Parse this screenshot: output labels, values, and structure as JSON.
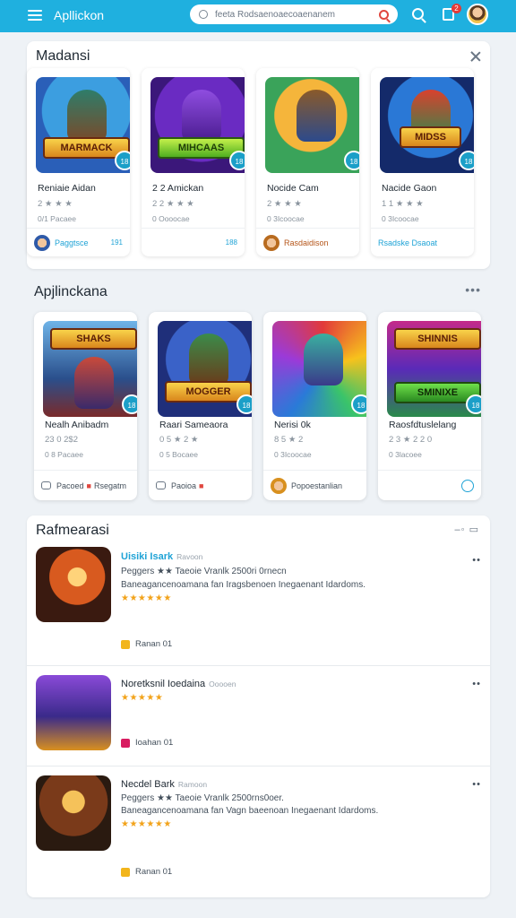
{
  "topbar": {
    "app_title": "Apllickon",
    "search_placeholder": "feeta  Rodsaenoaecoaenanem",
    "notification_count": "2"
  },
  "section1": {
    "title": "Madansi",
    "cards": [
      {
        "title": "Reniaie Aidan",
        "rating": "2 ★ ★ ★",
        "sub": "0/1 Pacaee",
        "badge": "18",
        "foot": "Paggtsce",
        "foot_right": "191"
      },
      {
        "title": "2 2 Amickan",
        "rating": "2 2 ★ ★ ★",
        "sub": "0 Oooocae",
        "badge": "18",
        "foot": "",
        "foot_right": "188"
      },
      {
        "title": "Nocide Cam",
        "rating": "2 ★ ★ ★",
        "sub": "0 3Icoocae",
        "badge": "18",
        "foot": "Rasdaidison",
        "foot_right": ""
      },
      {
        "title": "Nacide Gaon",
        "rating": "1 1 ★ ★ ★",
        "sub": "0 3Icoocae",
        "badge": "18",
        "foot": "Rsadske Dsaoat",
        "foot_right": ""
      }
    ]
  },
  "section2": {
    "title": "Apjlinckana",
    "cards": [
      {
        "title": "Nealh Anibadm",
        "rating": "23 0 2$2",
        "sub": "0 8 Pacaee",
        "badge": "18",
        "foot": "Pacoed",
        "foot_right": "Rsegatm"
      },
      {
        "title": "Raari Sameaora",
        "rating": "0 5 ★ 2 ★",
        "sub": "0 5 Bocaee",
        "badge": "18",
        "foot": "Paoioa",
        "foot_right": ""
      },
      {
        "title": "Nerisi 0k",
        "rating": "8 5 ★ 2",
        "sub": "0 3Icoocae",
        "badge": "18",
        "foot": "Popoestanlian",
        "foot_right": ""
      },
      {
        "title": "Raosfdtuslelang",
        "rating": "2 3 ★ 2 2 0",
        "sub": "0 3lacoee",
        "badge": "18",
        "foot": "",
        "foot_right": ""
      }
    ]
  },
  "section3": {
    "title": "Rafmearasi",
    "rows": [
      {
        "title": "Uisiki Isark",
        "tag": "Ravoon",
        "line1": "Peggers ★★  Taeoie Vranlk 2500ri 0rnecn",
        "line2": "Baneagancenoamana fan Iragsbenoen Inegaenant Idardoms.",
        "stars": "★★★★★★",
        "badge": "Ranan 01",
        "badge_color": "#f2b51b"
      },
      {
        "title": "Noretksnil Ioedaina",
        "tag": "Ooooen",
        "line1": "",
        "line2": "",
        "stars": "★★★★★",
        "badge": "Ioahan 01",
        "badge_color": "#d81b60"
      },
      {
        "title": "Necdel Bark",
        "tag": "Ramoon",
        "line1": "Peggers ★★  Taeoie Vranlk 2500rns0oer.",
        "line2": "Baneagancenoamana fan Vagn baeenoan Inegaenant Idardoms.",
        "stars": "★★★★★★",
        "badge": "Ranan 01",
        "badge_color": "#f2b51b"
      }
    ]
  },
  "colors": {
    "accent": "#1fb0df",
    "star": "#f2a31b"
  }
}
